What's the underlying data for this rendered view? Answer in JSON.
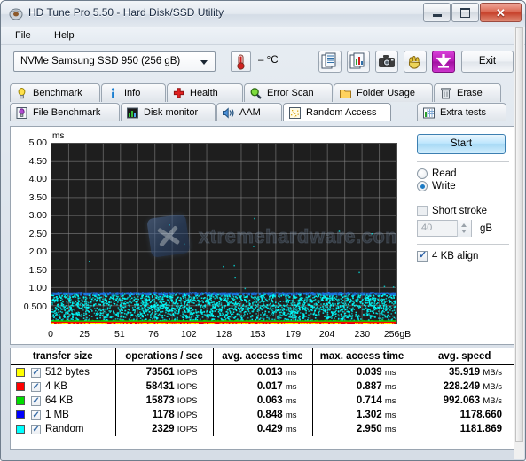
{
  "window": {
    "title": "HD Tune Pro 5.50 - Hard Disk/SSD Utility",
    "app_icon": "hdtune-logo-icon",
    "minimize_label": "",
    "maximize_label": "",
    "close_label": "✕"
  },
  "menu": {
    "items": [
      {
        "label": "File",
        "accel": "F"
      },
      {
        "label": "Help",
        "accel": "H"
      }
    ]
  },
  "toolbar": {
    "drive": {
      "bus": "NVMe",
      "model": "Samsung SSD 950 (256 gB)",
      "display": "NVMe    Samsung SSD 950 (256 gB)"
    },
    "temperature": {
      "icon": "thermometer-icon",
      "value": "– °C"
    },
    "buttons": [
      {
        "name": "copy-text-icon",
        "label": ""
      },
      {
        "name": "copy-graph-icon",
        "label": ""
      },
      {
        "name": "camera-icon",
        "label": ""
      },
      {
        "name": "clipboard-hand-icon",
        "label": ""
      },
      {
        "name": "save-download-icon",
        "label": ""
      }
    ],
    "exit_label": "Exit"
  },
  "tabs": {
    "row1": [
      {
        "label": "Benchmark",
        "icon": "lightbulb-icon",
        "active": false
      },
      {
        "label": "Info",
        "icon": "info-icon",
        "active": false
      },
      {
        "label": "Health",
        "icon": "red-cross-icon",
        "active": false
      },
      {
        "label": "Error Scan",
        "icon": "magnifier-icon",
        "active": false
      },
      {
        "label": "Folder Usage",
        "icon": "folder-icon",
        "active": false
      },
      {
        "label": "Erase",
        "icon": "trash-icon",
        "active": false
      }
    ],
    "row2": [
      {
        "label": "File Benchmark",
        "icon": "purple-bulb-icon",
        "active": false
      },
      {
        "label": "Disk monitor",
        "icon": "bar-chart-icon",
        "active": false
      },
      {
        "label": "AAM",
        "icon": "speaker-icon",
        "active": false
      },
      {
        "label": "Random Access",
        "icon": "scatter-dots-icon",
        "active": true
      },
      {
        "label": "Extra tests",
        "icon": "grid-chart-icon",
        "active": false
      }
    ]
  },
  "controls": {
    "start_label": "Start",
    "mode": {
      "read_label": "Read",
      "write_label": "Write",
      "selected": "Write"
    },
    "short_stroke": {
      "label": "Short stroke",
      "checked": false,
      "value": "40",
      "unit": "gB",
      "enabled": false
    },
    "align": {
      "label": "4 KB align",
      "checked": true
    }
  },
  "watermark": {
    "text": "xtremehardware.com",
    "logo": "x-tile-logo"
  },
  "chart_data": {
    "type": "scatter",
    "title": "",
    "xlabel": "",
    "ylabel": "ms",
    "y_unit": "ms",
    "x_unit": "gB",
    "ylim": [
      0,
      5
    ],
    "xlim": [
      0,
      256
    ],
    "yticks": [
      "5.00",
      "4.50",
      "4.00",
      "3.50",
      "3.00",
      "2.50",
      "2.00",
      "1.50",
      "1.00",
      "0.500"
    ],
    "ytick_values": [
      5.0,
      4.5,
      4.0,
      3.5,
      3.0,
      2.5,
      2.0,
      1.5,
      1.0,
      0.5
    ],
    "xticks": [
      "0",
      "25",
      "51",
      "76",
      "102",
      "128",
      "153",
      "179",
      "204",
      "230",
      "256gB"
    ],
    "xtick_values": [
      0,
      25,
      51,
      76,
      102,
      128,
      153,
      179,
      204,
      230,
      256
    ],
    "grid": true,
    "background": "#1e1e1e",
    "grid_color": "#8a8a8a",
    "legend_position": "below-table",
    "series": [
      {
        "name": "512 bytes",
        "color": "#ffff00",
        "mean_ms": 0.013,
        "max_ms": 0.039,
        "band": "bottom-dotted"
      },
      {
        "name": "4 KB",
        "color": "#ff0000",
        "mean_ms": 0.017,
        "max_ms": 0.887,
        "band": "bottom-line"
      },
      {
        "name": "64 KB",
        "color": "#00dd00",
        "mean_ms": 0.063,
        "max_ms": 0.714,
        "band": "bottom-line"
      },
      {
        "name": "1 MB",
        "color": "#1d6fe0",
        "mean_ms": 0.848,
        "max_ms": 1.302,
        "band": "dense-line-0.85ms"
      },
      {
        "name": "Random",
        "color": "#00ffff",
        "mean_ms": 0.429,
        "max_ms": 2.95,
        "band": "scatter-0.05-0.85ms"
      }
    ]
  },
  "results": {
    "headers": [
      "transfer size",
      "operations / sec",
      "avg. access time",
      "max. access time",
      "avg. speed"
    ],
    "rows": [
      {
        "color": "#ffff00",
        "checked": true,
        "transfer_size": "512 bytes",
        "ops": "73561 IOPS",
        "avg_access": "0.013 ms",
        "max_access": "0.039 ms",
        "avg_speed": "35.919 MB/s"
      },
      {
        "color": "#ff0000",
        "checked": true,
        "transfer_size": "4 KB",
        "ops": "58431 IOPS",
        "avg_access": "0.017 ms",
        "max_access": "0.887 ms",
        "avg_speed": "228.249 MB/s"
      },
      {
        "color": "#00dd00",
        "checked": true,
        "transfer_size": "64 KB",
        "ops": "15873 IOPS",
        "avg_access": "0.063 ms",
        "max_access": "0.714 ms",
        "avg_speed": "992.063 MB/s"
      },
      {
        "color": "#0000ff",
        "checked": true,
        "transfer_size": "1 MB",
        "ops": "1178 IOPS",
        "avg_access": "0.848 ms",
        "max_access": "1.302 ms",
        "avg_speed": "1178.660"
      },
      {
        "color": "#00ffff",
        "checked": true,
        "transfer_size": "Random",
        "ops": "2329 IOPS",
        "avg_access": "0.429 ms",
        "max_access": "2.950 ms",
        "avg_speed": "1181.869"
      }
    ]
  }
}
